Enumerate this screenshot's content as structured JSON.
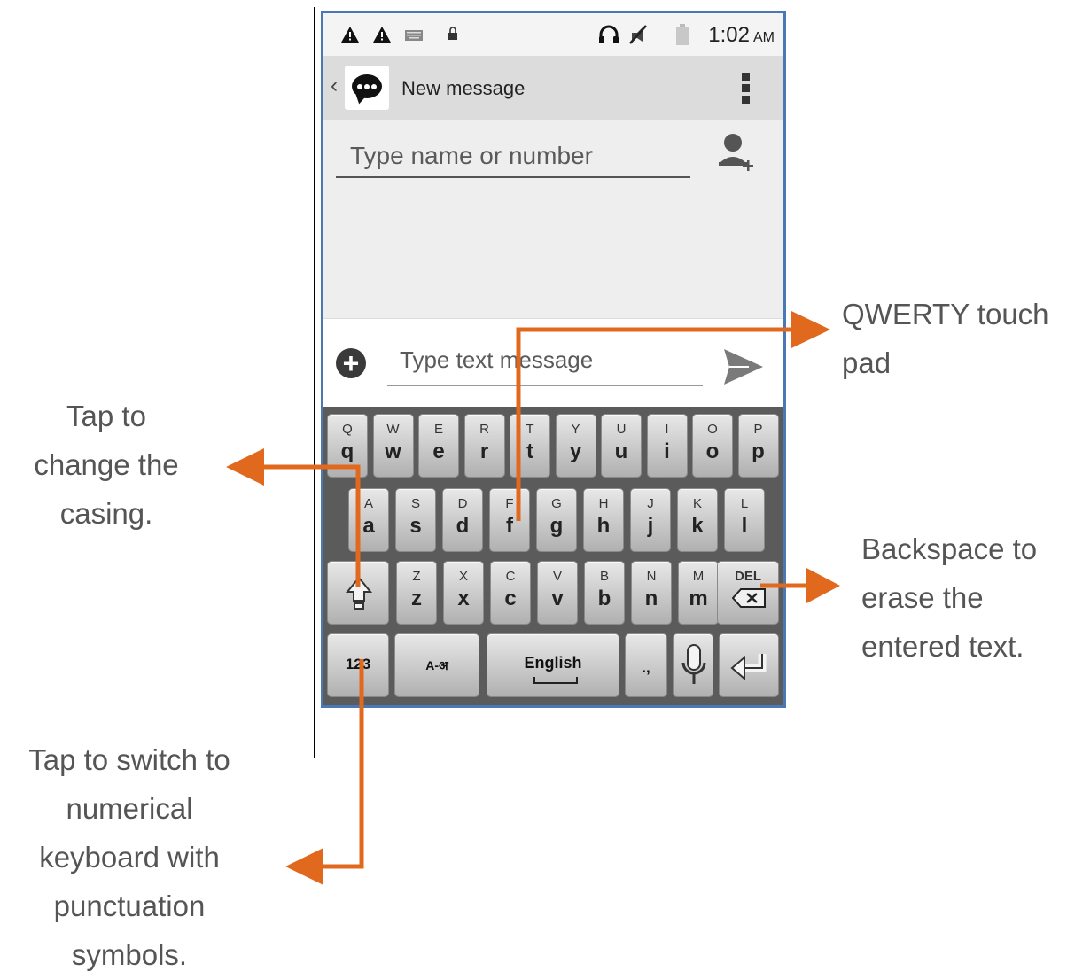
{
  "status_bar": {
    "time": "1:02",
    "ampm": "AM",
    "icons": [
      "warning-icon",
      "warning-icon",
      "keyboard-icon",
      "lock-icon",
      "headset-icon",
      "mute-icon",
      "battery-icon"
    ]
  },
  "action_bar": {
    "title": "New message",
    "app_icon": "message-bubble-icon",
    "overflow_icon": "overflow-menu-icon"
  },
  "recipient": {
    "placeholder": "Type name or number",
    "add_contact_icon": "add-contact-icon"
  },
  "compose": {
    "placeholder": "Type text message",
    "attach_icon": "plus-circle-icon",
    "send_icon": "send-icon"
  },
  "keyboard": {
    "row1": [
      {
        "up": "Q",
        "low": "q"
      },
      {
        "up": "W",
        "low": "w"
      },
      {
        "up": "E",
        "low": "e"
      },
      {
        "up": "R",
        "low": "r"
      },
      {
        "up": "T",
        "low": "t"
      },
      {
        "up": "Y",
        "low": "y"
      },
      {
        "up": "U",
        "low": "u"
      },
      {
        "up": "I",
        "low": "i"
      },
      {
        "up": "O",
        "low": "o"
      },
      {
        "up": "P",
        "low": "p"
      }
    ],
    "row2": [
      {
        "up": "A",
        "low": "a"
      },
      {
        "up": "S",
        "low": "s"
      },
      {
        "up": "D",
        "low": "d"
      },
      {
        "up": "F",
        "low": "f"
      },
      {
        "up": "G",
        "low": "g"
      },
      {
        "up": "H",
        "low": "h"
      },
      {
        "up": "J",
        "low": "j"
      },
      {
        "up": "K",
        "low": "k"
      },
      {
        "up": "L",
        "low": "l"
      }
    ],
    "row3": [
      {
        "up": "Z",
        "low": "z"
      },
      {
        "up": "X",
        "low": "x"
      },
      {
        "up": "C",
        "low": "c"
      },
      {
        "up": "V",
        "low": "v"
      },
      {
        "up": "B",
        "low": "b"
      },
      {
        "up": "N",
        "low": "n"
      },
      {
        "up": "M",
        "low": "m"
      }
    ],
    "shift_icon": "shift-icon",
    "del_label": "DEL",
    "numeric_label": "123",
    "lang_switch_label": "A-अ",
    "space_label": "English",
    "punct_label": ".,",
    "mic_icon": "microphone-icon",
    "enter_icon": "enter-icon"
  },
  "annotations": {
    "qwerty": [
      "QWERTY touch",
      "pad"
    ],
    "casing": [
      "Tap to",
      "change the",
      "casing."
    ],
    "backspace": [
      "Backspace to",
      "erase the",
      "entered text."
    ],
    "numeric": [
      "Tap to switch to",
      "numerical",
      "keyboard with",
      "punctuation",
      "symbols."
    ]
  },
  "colors": {
    "arrow": "#e0691e",
    "phone_border": "#4a78b4",
    "keyboard_bg": "#5b5b5b"
  }
}
